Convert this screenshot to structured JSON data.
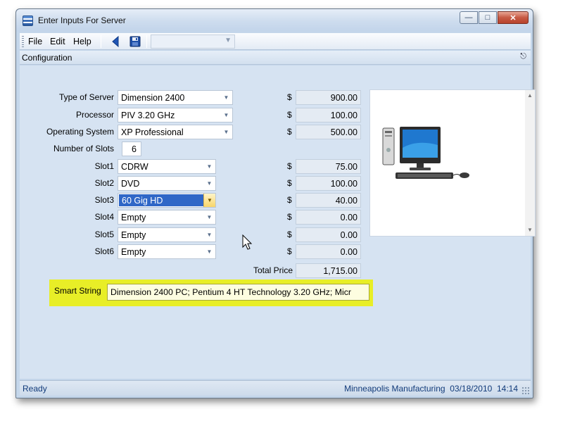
{
  "window": {
    "title": "Enter Inputs For Server"
  },
  "menu": {
    "file": "File",
    "edit": "Edit",
    "help": "Help"
  },
  "toolbar": {
    "combo_value": ""
  },
  "panel": {
    "title": "Configuration"
  },
  "form": {
    "type_of_server": {
      "label": "Type of Server",
      "value": "Dimension 2400",
      "price": "900.00"
    },
    "processor": {
      "label": "Processor",
      "value": "PIV 3.20 GHz",
      "price": "100.00"
    },
    "operating_system": {
      "label": "Operating System",
      "value": "XP Professional",
      "price": "500.00"
    },
    "number_of_slots": {
      "label": "Number of Slots",
      "value": "6"
    },
    "slots": [
      {
        "label": "Slot1",
        "value": "CDRW",
        "price": "75.00"
      },
      {
        "label": "Slot2",
        "value": "DVD",
        "price": "100.00"
      },
      {
        "label": "Slot3",
        "value": "60 Gig HD",
        "price": "40.00"
      },
      {
        "label": "Slot4",
        "value": "Empty",
        "price": "0.00"
      },
      {
        "label": "Slot5",
        "value": "Empty",
        "price": "0.00"
      },
      {
        "label": "Slot6",
        "value": "Empty",
        "price": "0.00"
      }
    ],
    "currency": "$",
    "total_label": "Total Price",
    "total_value": "1,715.00"
  },
  "smart_string": {
    "label": "Smart String",
    "value": "Dimension 2400 PC; Pentium 4 HT Technology 3.20 GHz; Micr"
  },
  "status": {
    "left": "Ready",
    "company": "Minneapolis Manufacturing",
    "date": "03/18/2010",
    "time": "14:14"
  },
  "colors": {
    "highlight": "#e8ee27",
    "selection": "#2f67c7",
    "panel_bg": "#d6e3f2"
  }
}
